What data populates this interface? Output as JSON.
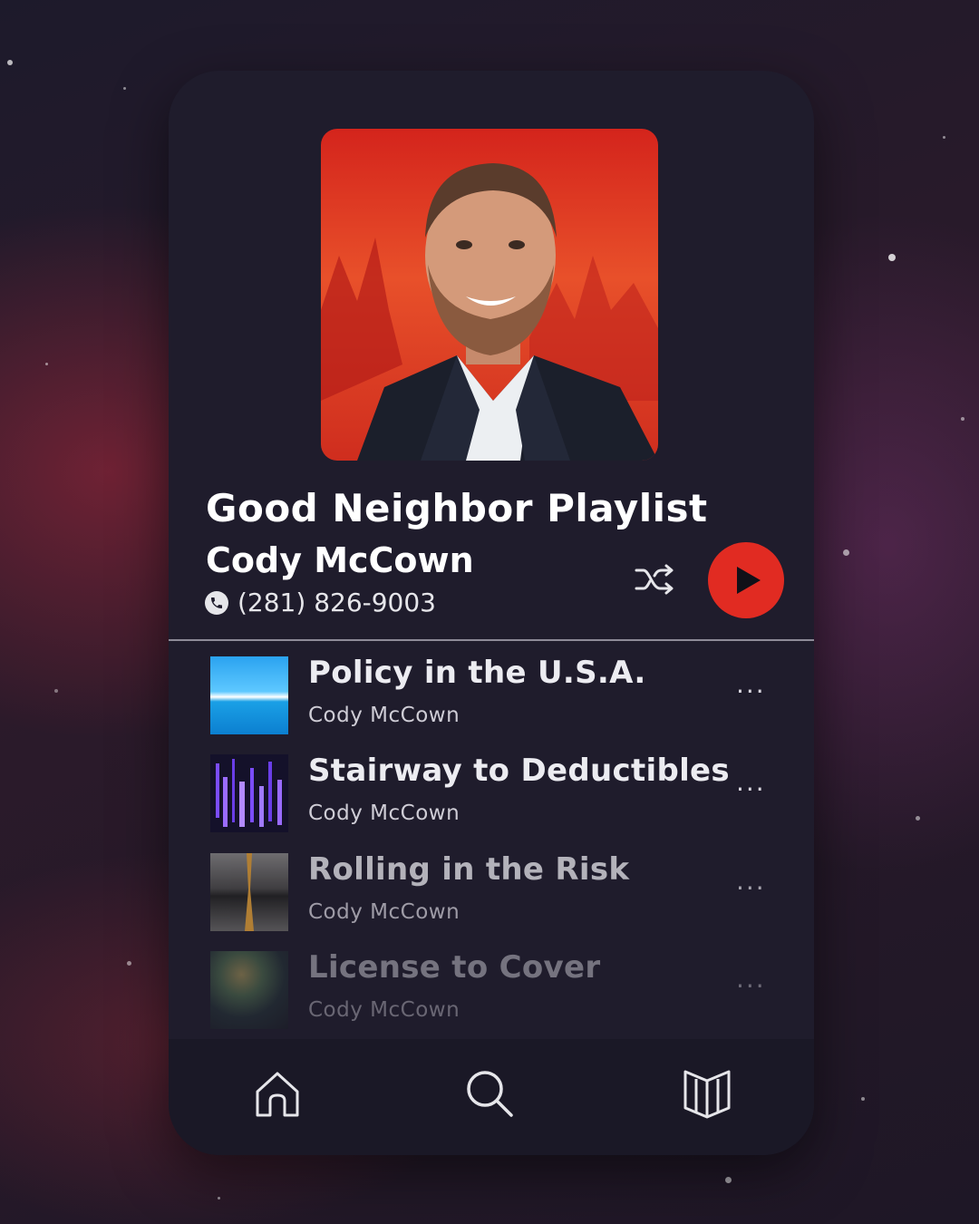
{
  "playlist": {
    "title": "Good Neighbor Playlist",
    "artist": "Cody McCown",
    "phone": "(281) 826-9003"
  },
  "controls": {
    "shuffle_icon": "shuffle-icon",
    "play_icon": "play-icon",
    "accent_color": "#e12b22"
  },
  "tracks": [
    {
      "title": "Policy in the U.S.A.",
      "artist": "Cody McCown",
      "more": "..."
    },
    {
      "title": "Stairway to Deductibles",
      "artist": "Cody McCown",
      "more": "..."
    },
    {
      "title": "Rolling in the Risk",
      "artist": "Cody McCown",
      "more": "..."
    },
    {
      "title": "License to Cover",
      "artist": "Cody McCown",
      "more": "..."
    }
  ],
  "nav": {
    "items": [
      "home-icon",
      "search-icon",
      "library-icon"
    ]
  }
}
